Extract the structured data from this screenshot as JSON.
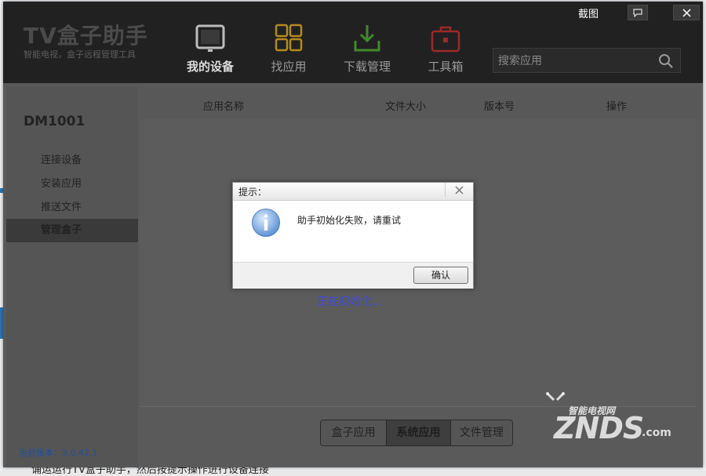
{
  "background": {
    "caption": "诵运运行TV盒子助手，然后按提示操作进行设备连接"
  },
  "titlebar": {
    "logo": "TV盒子助手",
    "logo_sub": "智能电视，盒子远程管理工具",
    "screenshot_label": "截图",
    "nav": [
      {
        "label": "我的设备",
        "icon": "tv-icon",
        "active": true
      },
      {
        "label": "找应用",
        "icon": "grid-icon",
        "active": false
      },
      {
        "label": "下载管理",
        "icon": "download-icon",
        "active": false
      },
      {
        "label": "工具箱",
        "icon": "toolbox-icon",
        "active": false
      }
    ],
    "search_placeholder": "搜索应用"
  },
  "sidebar": {
    "device_name": "DM1001",
    "items": [
      {
        "label": "连接设备"
      },
      {
        "label": "安装应用"
      },
      {
        "label": "推送文件"
      },
      {
        "label": "管理盒子"
      }
    ],
    "version": "当前版本：3.0.42.1"
  },
  "table": {
    "headers": [
      "应用名称",
      "文件大小",
      "版本号",
      "操作"
    ]
  },
  "status": {
    "loading": "正在初始化..."
  },
  "bottom_tabs": [
    {
      "label": "盒子应用",
      "active": false
    },
    {
      "label": "系统应用",
      "active": true
    },
    {
      "label": "文件管理",
      "active": false
    }
  ],
  "dialog": {
    "title": "提示：",
    "message": "助手初始化失败，请重试",
    "ok_label": "确认",
    "icon": "info-icon"
  },
  "watermark": {
    "brand": "ZNDS",
    "domain": ".com",
    "tagline": "智能电视网"
  },
  "colors": {
    "titlebar": "#212121",
    "overlay": "#5a5a5a",
    "loading_text": "#3d4cd8",
    "version_text": "#1f4fa0"
  }
}
